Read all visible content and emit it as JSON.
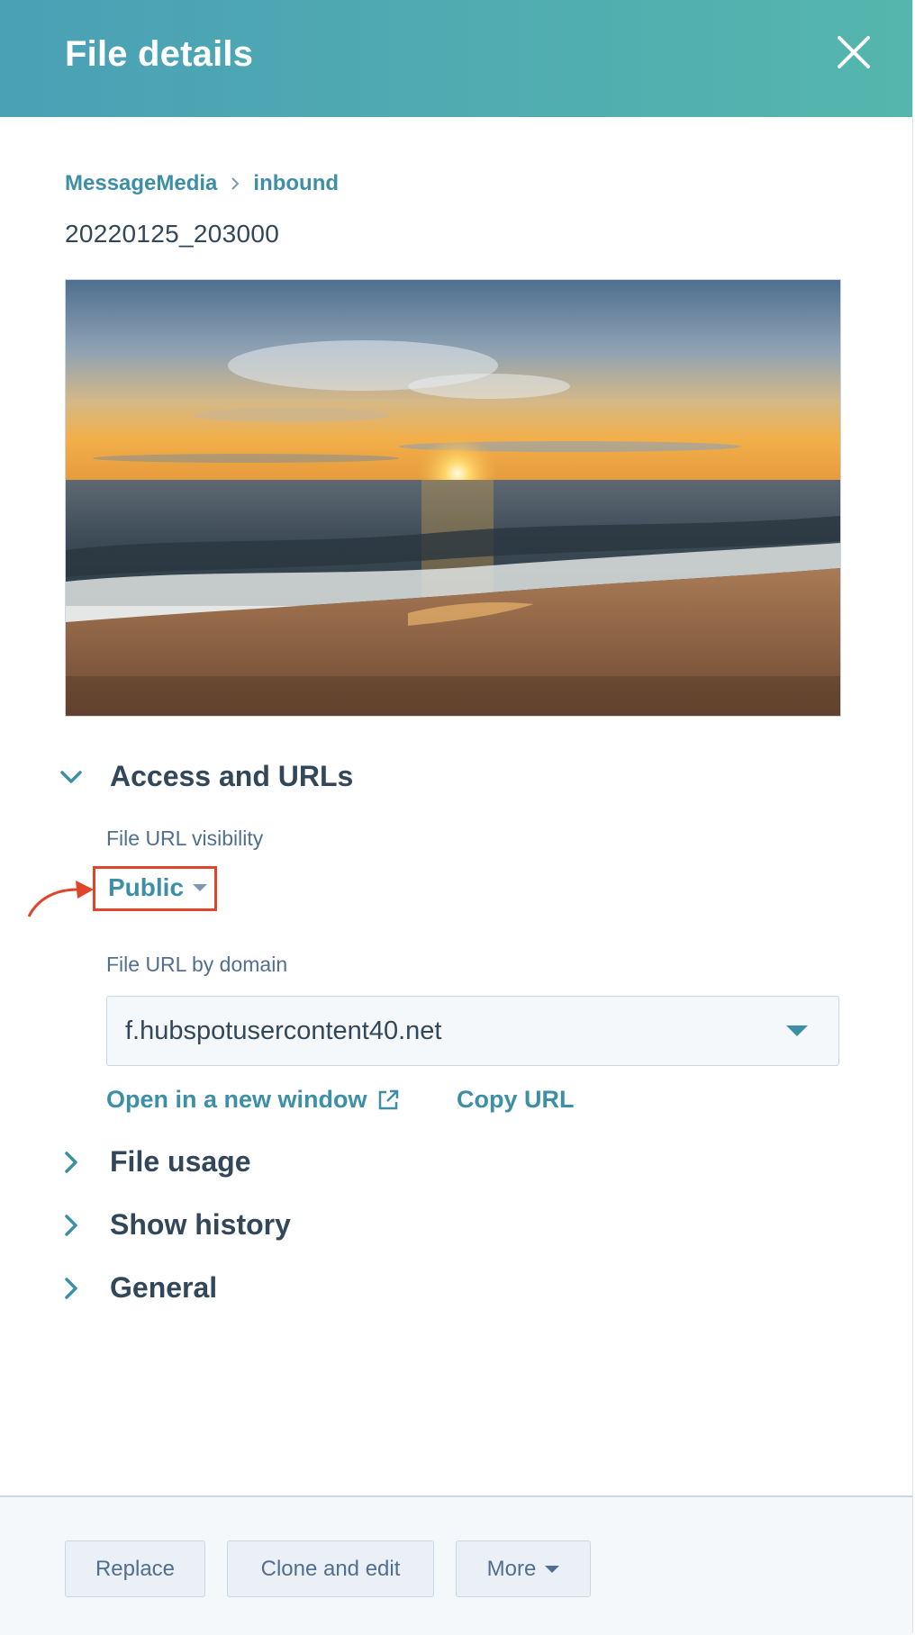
{
  "header": {
    "title": "File details",
    "close_icon": "close-icon"
  },
  "breadcrumb": {
    "items": [
      "MessageMedia",
      "inbound"
    ],
    "separator_icon": "chevron-right-icon"
  },
  "file": {
    "name": "20220125_203000",
    "preview_alt": "Sunset over the ocean with waves on a sandy beach"
  },
  "sections": {
    "access": {
      "label": "Access and URLs",
      "expanded": true
    },
    "usage": {
      "label": "File usage",
      "expanded": false
    },
    "history": {
      "label": "Show history",
      "expanded": false
    },
    "general": {
      "label": "General",
      "expanded": false
    }
  },
  "access": {
    "visibility_label": "File URL visibility",
    "visibility_value": "Public",
    "domain_label": "File URL by domain",
    "domain_value": "f.hubspotusercontent40.net",
    "open_link": "Open in a new window",
    "copy_link": "Copy URL"
  },
  "footer": {
    "replace": "Replace",
    "clone_edit": "Clone and edit",
    "more": "More"
  },
  "colors": {
    "accent": "#3d8fa6",
    "header_start": "#4aa0b5",
    "header_end": "#55b6ad",
    "highlight": "#e0452b",
    "text": "#33475b"
  }
}
